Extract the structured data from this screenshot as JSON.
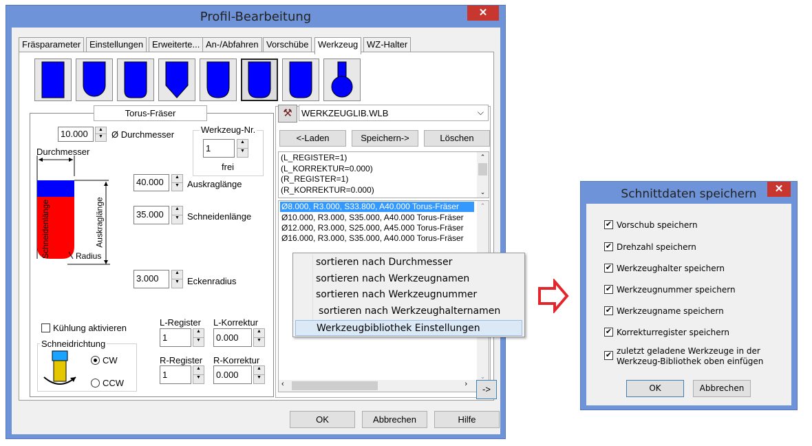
{
  "dialog": {
    "title": "Profil-Bearbeitung",
    "tabs": [
      {
        "label": "Fräsparameter"
      },
      {
        "label": "Einstellungen"
      },
      {
        "label": "Erweiterte..."
      },
      {
        "label": "An-/Abfahren"
      },
      {
        "label": "Vorschübe"
      },
      {
        "label": "Werkzeug"
      },
      {
        "label": "WZ-Halter"
      }
    ],
    "active_tab": "Werkzeug",
    "tool_type_label": "Torus-Fräser",
    "diameter_value": "10.000",
    "diameter_label": "Ø Durchmesser",
    "tool_nr_title": "Werkzeug-Nr.",
    "tool_nr_value": "1",
    "tool_nr_status": "frei",
    "illus": {
      "durchmesser": "Durchmesser",
      "schneidenlaenge": "Schneidenlänge",
      "auskraglaenge": "Auskraglänge",
      "radius": "Radius"
    },
    "overhang_value": "40.000",
    "overhang_label": "Auskraglänge",
    "cutting_length_value": "35.000",
    "cutting_length_label": "Schneidenlänge",
    "corner_radius_value": "3.000",
    "corner_radius_label": "Eckenradius",
    "coolant_label": "Kühlung aktivieren",
    "coolant_checked": false,
    "direction_title": "Schneidrichtung",
    "direction_cw": "CW",
    "direction_ccw": "CCW",
    "direction_selected": "CW",
    "l_register_label": "L-Register",
    "l_register_value": "1",
    "l_korrektur_label": "L-Korrektur",
    "l_korrektur_value": "0.000",
    "r_register_label": "R-Register",
    "r_register_value": "1",
    "r_korrektur_label": "R-Korrektur",
    "r_korrektur_value": "0.000",
    "library_file": "WERKZEUGLIB.WLB",
    "load_button": "<-Laden",
    "save_button": "Speichern->",
    "delete_button": "Löschen",
    "params_lines": [
      "(L_REGISTER=1)",
      "(L_KORREKTUR=0.000)",
      "(R_REGISTER=1)",
      "(R_KORREKTUR=0.000)"
    ],
    "tool_list": [
      "Ø8.000, R3.000, S33.800, A40.000  Torus-Fräser",
      "Ø10.000, R3.000, S35.000, A40.000  Torus-Fräser",
      "Ø12.000, R3.000, S25.000, A45.000  Torus-Fräser",
      "Ø16.000, R3.000, S35.000, A40.000  Torus-Fräser"
    ],
    "arrow_button": "->",
    "ok": "OK",
    "cancel": "Abbrechen",
    "help": "Hilfe"
  },
  "context_menu": [
    "sortieren nach Durchmesser",
    "sortieren nach Werkzeugnamen",
    "sortieren nach Werkzeugnummer",
    "sortieren nach Werkzeughalternamen",
    "Werkzeugbibliothek Einstellungen"
  ],
  "save_dialog": {
    "title": "Schnittdaten speichern",
    "options": [
      {
        "label": "Vorschub speichern",
        "checked": true
      },
      {
        "label": "Drehzahl speichern",
        "checked": true
      },
      {
        "label": "Werkzeughalter speichern",
        "checked": true
      },
      {
        "label": "Werkzeugnummer speichern",
        "checked": true
      },
      {
        "label": "Werkzeugname speichern",
        "checked": true
      },
      {
        "label": "Korrekturregister speichern",
        "checked": true
      }
    ],
    "last_option_line1": "zuletzt geladene Werkzeuge in der",
    "last_option_line2": "Werkzeug-Bibliothek oben einfügen",
    "ok": "OK",
    "cancel": "Abbrechen"
  },
  "colors": {
    "frame": "#6f93d8",
    "close": "#c7372f",
    "tool_blue": "#0000ff",
    "tool_red": "#ff0000",
    "selection": "#3399ff",
    "arrow": "#e3262b"
  }
}
